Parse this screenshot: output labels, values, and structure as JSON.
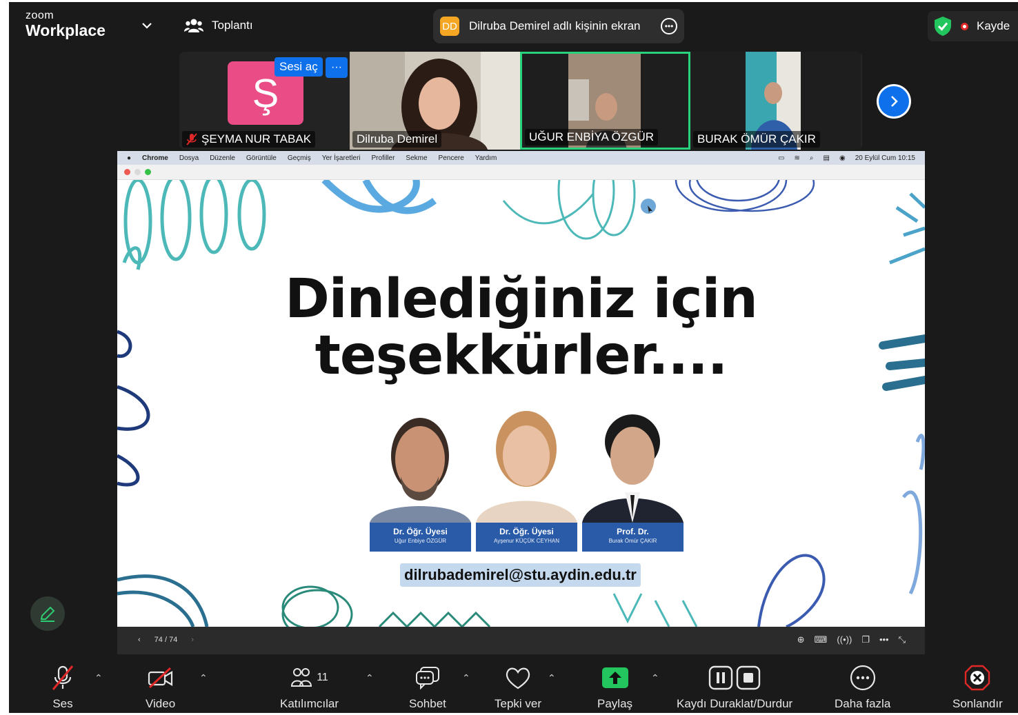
{
  "app": {
    "brand_small": "zoom",
    "brand_big": "Workplace",
    "meeting_label": "Toplantı"
  },
  "share_indicator": {
    "initials": "DD",
    "text": "Dilruba Demirel adlı kişinin ekran",
    "accent_color": "#f5a623"
  },
  "recording": {
    "label": "Kayde"
  },
  "participants": [
    {
      "name": "ŞEYMA NUR TABAK",
      "avatar_letter": "Ş",
      "muted": true,
      "unmute_label": "Sesi aç",
      "more_label": "···"
    },
    {
      "name": "Dilruba Demirel"
    },
    {
      "name": "UĞUR ENBİYA ÖZGÜR",
      "active": true
    },
    {
      "name": "BURAK ÖMÜR ÇAKIR"
    }
  ],
  "mac_menu": {
    "items": [
      "Chrome",
      "Dosya",
      "Düzenle",
      "Görüntüle",
      "Geçmiş",
      "Yer İşaretleri",
      "Profiller",
      "Sekme",
      "Pencere",
      "Yardım"
    ],
    "clock": "20 Eylül Cum  10:15"
  },
  "slide": {
    "title_line1": "Dinlediğiniz için",
    "title_line2": "teşekkürler....",
    "people": [
      {
        "role": "Dr. Öğr. Üyesi",
        "name": "Uğur Enbiye ÖZGÜR"
      },
      {
        "role": "Dr. Öğr. Üyesi",
        "name": "Ayşenur KÜÇÜK CEYHAN"
      },
      {
        "role": "Prof. Dr.",
        "name": "Burak Ömür ÇAKIR"
      }
    ],
    "email": "dilrubademirel@stu.aydin.edu.tr"
  },
  "presentation": {
    "page": "74 / 74"
  },
  "toolbar": {
    "audio": "Ses",
    "video": "Video",
    "participants": "Katılımcılar",
    "participants_count": "11",
    "chat": "Sohbet",
    "react": "Tepki ver",
    "share": "Paylaş",
    "record": "Kaydı Duraklat/Durdur",
    "more": "Daha fazla",
    "end": "Sonlandır"
  },
  "colors": {
    "share_green": "#22c55e",
    "end_red": "#e02828",
    "active_border": "#28d17c",
    "blue": "#0e71eb"
  }
}
